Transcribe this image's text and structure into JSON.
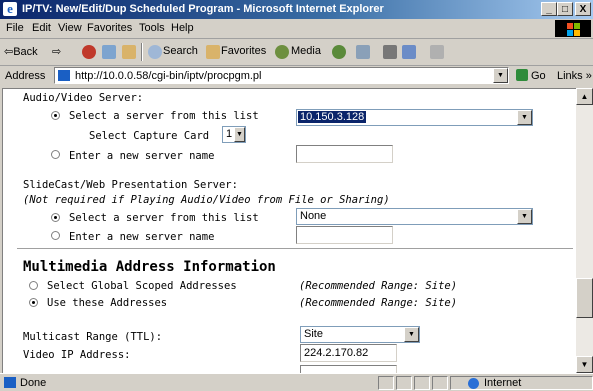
{
  "window": {
    "title": "IP/TV: New/Edit/Dup Scheduled Program - Microsoft Internet Explorer",
    "minimize_label": "_",
    "maximize_label": "□",
    "close_label": "X"
  },
  "menu": [
    "File",
    "Edit",
    "View",
    "Favorites",
    "Tools",
    "Help"
  ],
  "toolbar": {
    "back_label": "⇦Back",
    "forward_label": "⇨",
    "search_label": "Search",
    "favorites_label": "Favorites",
    "media_label": "Media"
  },
  "address": {
    "label": "Address",
    "url": "http://10.0.0.58/cgi-bin/iptv/procpgm.pl",
    "go_label": "Go",
    "links_label": "Links »"
  },
  "form": {
    "av_server_heading": "Audio/Video Server:",
    "av_select_label": "Select a server from this list",
    "av_server_value": "10.150.3.128",
    "capture_card_label": "Select Capture Card",
    "capture_card_value": "1",
    "av_new_label": "Enter a new server name",
    "slidecast_heading": "SlideCast/Web Presentation Server:",
    "slidecast_note": "(Not required if Playing Audio/Video from File or Sharing)",
    "sc_select_label": "Select a server from this list",
    "sc_server_value": "None",
    "sc_new_label": "Enter a new server name",
    "multimedia_heading": "Multimedia Address Information",
    "global_scoped_label": "Select Global Scoped Addresses",
    "global_scoped_range": "(Recommended Range: Site)",
    "use_these_label": "Use these Addresses",
    "use_these_range": "(Recommended Range: Site)",
    "multicast_range_label": "Multicast Range (TTL):",
    "multicast_range_value": "Site",
    "video_ip_label": "Video IP Address:",
    "video_ip_value": "224.2.170.82"
  },
  "status": {
    "text": "Done",
    "zone": "Internet"
  }
}
